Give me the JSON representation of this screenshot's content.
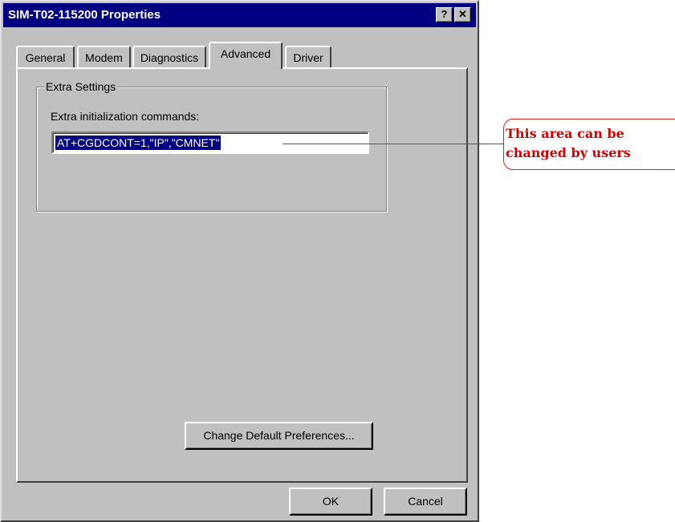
{
  "window": {
    "title": "SIM-T02-115200 Properties",
    "help_glyph": "?",
    "close_glyph": "✕"
  },
  "tabs": [
    {
      "label": "General",
      "active": false
    },
    {
      "label": "Modem",
      "active": false
    },
    {
      "label": "Diagnostics",
      "active": false
    },
    {
      "label": "Advanced",
      "active": true
    },
    {
      "label": "Driver",
      "active": false
    }
  ],
  "extra_settings": {
    "group_title": "Extra Settings",
    "field_label": "Extra initialization commands:",
    "field_value": "AT+CGDCONT=1,\"IP\",\"CMNET\""
  },
  "buttons": {
    "change_defaults": "Change Default Preferences...",
    "ok": "OK",
    "cancel": "Cancel"
  },
  "annotation": {
    "line1": "This area can be",
    "line2": "changed by users",
    "color": "#d02020"
  }
}
